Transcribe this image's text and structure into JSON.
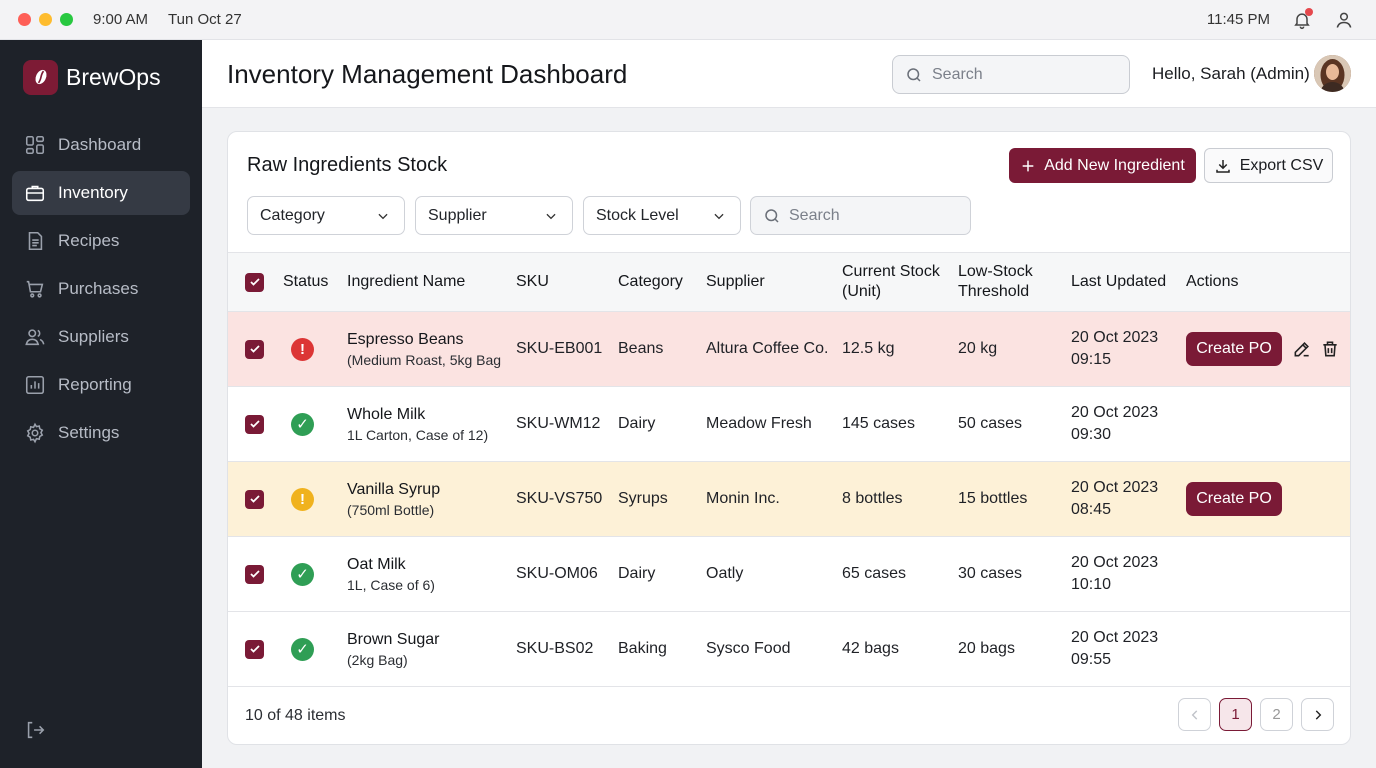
{
  "system": {
    "time_left": "9:00 AM",
    "date": "Tun Oct 27",
    "time_right": "11:45 PM"
  },
  "brand": {
    "name": "BrewOps"
  },
  "sidebar": {
    "items": [
      {
        "label": "Dashboard",
        "icon": "grid-icon",
        "active": false
      },
      {
        "label": "Inventory",
        "icon": "briefcase-icon",
        "active": true
      },
      {
        "label": "Recipes",
        "icon": "document-icon",
        "active": false
      },
      {
        "label": "Purchases",
        "icon": "cart-icon",
        "active": false
      },
      {
        "label": "Suppliers",
        "icon": "users-icon",
        "active": false
      },
      {
        "label": "Reporting",
        "icon": "chart-icon",
        "active": false
      },
      {
        "label": "Settings",
        "icon": "gear-icon",
        "active": false
      }
    ]
  },
  "header": {
    "title": "Inventory Management Dashboard",
    "search_placeholder": "Search",
    "greeting": "Hello, Sarah (Admin)"
  },
  "card": {
    "title": "Raw Ingredients Stock",
    "add_label": "Add New Ingredient",
    "export_label": "Export CSV",
    "filters": {
      "category": "Category",
      "supplier": "Supplier",
      "stock_level": "Stock Level",
      "search_placeholder": "Search"
    }
  },
  "table": {
    "headers": {
      "status": "Status",
      "name": "Ingredient Name",
      "sku": "SKU",
      "category": "Category",
      "supplier": "Supplier",
      "current_stock_1": "Current Stock",
      "current_stock_2": "(Unit)",
      "threshold_1": "Low-Stock",
      "threshold_2": "Threshold",
      "updated": "Last Updated",
      "actions": "Actions"
    },
    "rows": [
      {
        "status": "critical",
        "status_glyph": "!",
        "name": "Espresso Beans",
        "detail": "(Medium Roast, 5kg Bag",
        "sku": "SKU-EB001",
        "category": "Beans",
        "supplier": "Altura Coffee Co.",
        "stock": "12.5 kg",
        "threshold": "20 kg",
        "date": "20 Oct 2023",
        "time": "09:15",
        "action": "Create PO"
      },
      {
        "status": "ok",
        "status_glyph": "✓",
        "name": "Whole Milk",
        "detail": "1L Carton, Case of 12)",
        "sku": "SKU-WM12",
        "category": "Dairy",
        "supplier": "Meadow Fresh",
        "stock": "145 cases",
        "threshold": "50 cases",
        "date": "20 Oct 2023",
        "time": "09:30",
        "action": ""
      },
      {
        "status": "low",
        "status_glyph": "!",
        "name": "Vanilla Syrup",
        "detail": "(750ml Bottle)",
        "sku": "SKU-VS750",
        "category": "Syrups",
        "supplier": "Monin Inc.",
        "stock": "8 bottles",
        "threshold": "15 bottles",
        "date": "20 Oct 2023",
        "time": "08:45",
        "action": "Create PO"
      },
      {
        "status": "ok",
        "status_glyph": "✓",
        "name": "Oat Milk",
        "detail": "1L, Case of 6)",
        "sku": "SKU-OM06",
        "category": "Dairy",
        "supplier": "Oatly",
        "stock": "65 cases",
        "threshold": "30 cases",
        "date": "20 Oct 2023",
        "time": "10:10",
        "action": ""
      },
      {
        "status": "ok",
        "status_glyph": "✓",
        "name": "Brown Sugar",
        "detail": "(2kg Bag)",
        "sku": "SKU-BS02",
        "category": "Baking",
        "supplier": "Sysco Food",
        "stock": "42 bags",
        "threshold": "20 bags",
        "date": "20 Oct 2023",
        "time": "09:55",
        "action": ""
      }
    ]
  },
  "footer": {
    "count": "10 of 48 items",
    "pages": [
      "1",
      "2"
    ],
    "current_page": "1"
  },
  "colors": {
    "accent": "#7a1a36",
    "sidebar_bg": "#1e2229",
    "danger_row": "#fbe3e1",
    "warning_row": "#fdf1d7",
    "ok": "#2f9e55",
    "critical": "#dc3535",
    "low": "#f0b21e"
  }
}
